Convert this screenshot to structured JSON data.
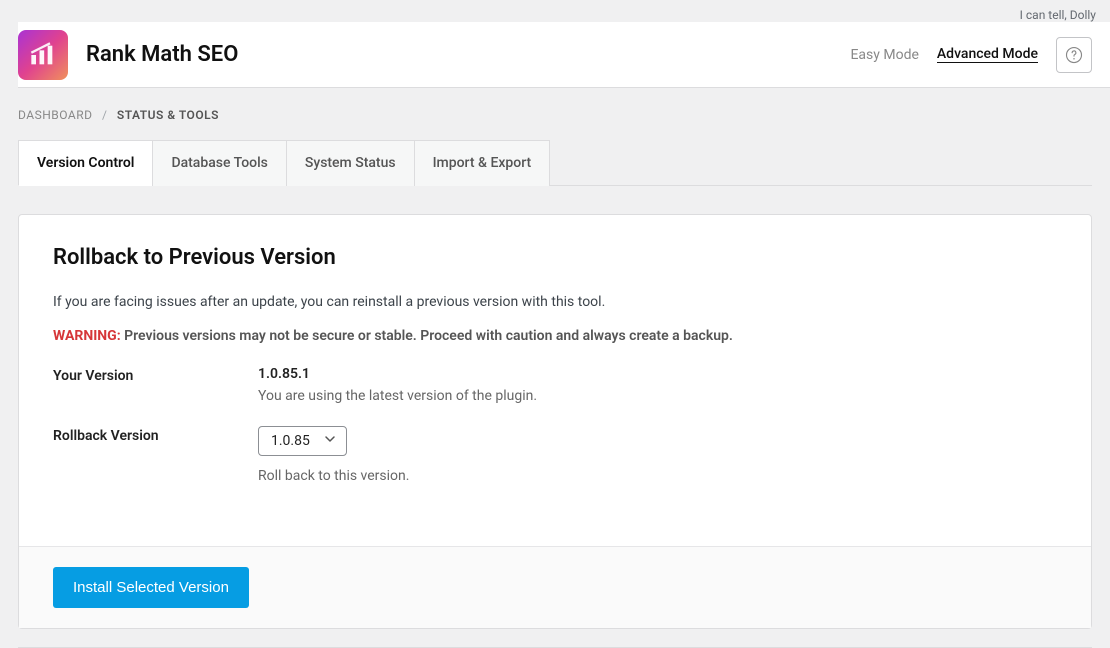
{
  "header": {
    "title": "Rank Math SEO",
    "mode_easy": "Easy Mode",
    "mode_advanced": "Advanced Mode"
  },
  "top_right": "I can tell, Dolly",
  "breadcrumb": {
    "first": "DASHBOARD",
    "sep": "/",
    "current": "STATUS & TOOLS"
  },
  "tabs": [
    {
      "label": "Version Control",
      "active": true
    },
    {
      "label": "Database Tools",
      "active": false
    },
    {
      "label": "System Status",
      "active": false
    },
    {
      "label": "Import & Export",
      "active": false
    }
  ],
  "panel": {
    "title": "Rollback to Previous Version",
    "description": "If you are facing issues after an update, you can reinstall a previous version with this tool.",
    "warning_label": "WARNING:",
    "warning_text": "Previous versions may not be secure or stable. Proceed with caution and always create a backup.",
    "your_version_label": "Your Version",
    "your_version_value": "1.0.85.1",
    "your_version_sub": "You are using the latest version of the plugin.",
    "rollback_label": "Rollback Version",
    "rollback_selected": "1.0.85",
    "rollback_sub": "Roll back to this version.",
    "install_button": "Install Selected Version"
  }
}
